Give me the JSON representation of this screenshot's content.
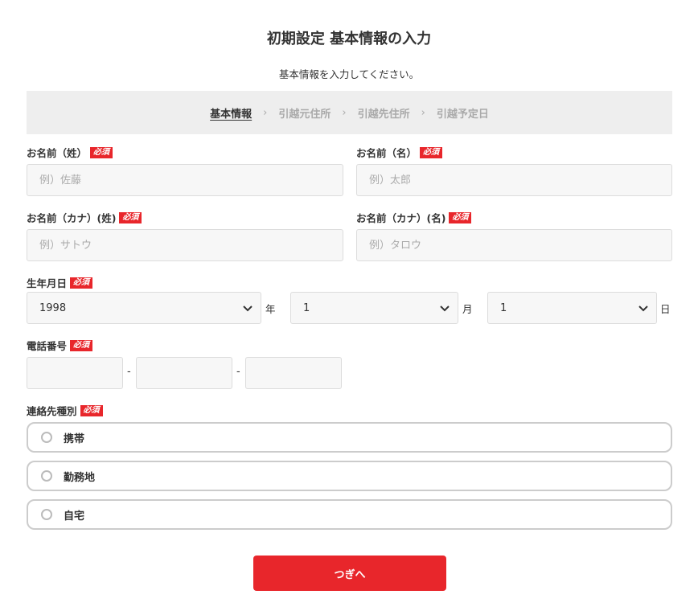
{
  "header": {
    "title": "初期設定 基本情報の入力",
    "subtitle": "基本情報を入力してください。"
  },
  "steps": [
    {
      "label": "基本情報",
      "active": true
    },
    {
      "label": "引越元住所",
      "active": false
    },
    {
      "label": "引越先住所",
      "active": false
    },
    {
      "label": "引越予定日",
      "active": false
    }
  ],
  "required_badge": "必須",
  "form": {
    "last_name": {
      "label": "お名前（姓）",
      "placeholder": "例）佐藤",
      "value": ""
    },
    "first_name": {
      "label": "お名前（名）",
      "placeholder": "例）太郎",
      "value": ""
    },
    "last_name_kana": {
      "label": "お名前（カナ）(姓)",
      "placeholder": "例）サトウ",
      "value": ""
    },
    "first_name_kana": {
      "label": "お名前（カナ）(名)",
      "placeholder": "例）タロウ",
      "value": ""
    },
    "birthdate": {
      "label": "生年月日",
      "year": {
        "value": "1998",
        "unit": "年"
      },
      "month": {
        "value": "1",
        "unit": "月"
      },
      "day": {
        "value": "1",
        "unit": "日"
      }
    },
    "phone": {
      "label": "電話番号",
      "separator": "-",
      "part1": "",
      "part2": "",
      "part3": ""
    },
    "contact_type": {
      "label": "連絡先種別",
      "options": [
        "携帯",
        "勤務地",
        "自宅"
      ],
      "selected": null
    }
  },
  "actions": {
    "next_label": "つぎへ"
  },
  "colors": {
    "accent": "#e8262b",
    "step_bar": "#eeeeee",
    "input_bg": "#f7f7f7"
  }
}
